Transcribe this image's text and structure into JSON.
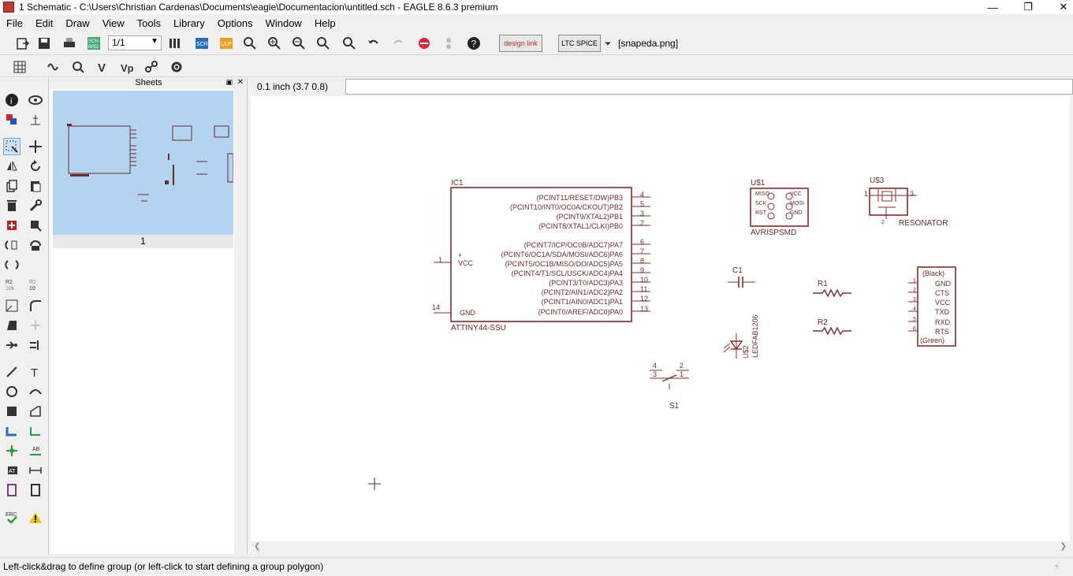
{
  "window": {
    "title": "1 Schematic - C:\\Users\\Christian Cardenas\\Documents\\eagle\\Documentacion\\untitled.sch - EAGLE 8.6.3 premium"
  },
  "menu": [
    "File",
    "Edit",
    "Draw",
    "View",
    "Tools",
    "Library",
    "Options",
    "Window",
    "Help"
  ],
  "toolbar": {
    "sheet_select": "1/1",
    "design_link": "design link",
    "ltc_spice": "LTC SPICE",
    "file_label": "[snapeda.png]"
  },
  "sheets_panel": {
    "title": "Sheets",
    "sheet_number": "1"
  },
  "coord": "0.1 inch (3.7 0.8)",
  "command_input": "",
  "status": "Left-click&drag to define group (or left-click to start defining a group polygon)",
  "schematic": {
    "ic1": {
      "name": "IC1",
      "value": "ATTINY44-SSU",
      "pins_right": [
        {
          "label": "(PCINT11/RESET/DW)PB3",
          "num": "4"
        },
        {
          "label": "(PCINT10/INT0/OC0A/CKOUT)PB2",
          "num": "5"
        },
        {
          "label": "(PCINT9/XTAL2)PB1",
          "num": "3"
        },
        {
          "label": "(PCINT8/XTAL1/CLKI)PB0",
          "num": "2"
        },
        {
          "label": "(PCINT7/ICP/OC0B/ADC7)PA7",
          "num": "6"
        },
        {
          "label": "(PCINT6/OC1A/SDA/MOSI/ADC6)PA6",
          "num": "7"
        },
        {
          "label": "(PCINT5/OC1B/MISO/DO/ADC5)PA5",
          "num": "8"
        },
        {
          "label": "(PCINT4/T1/SCL/USCK/ADC4)PA4",
          "num": "9"
        },
        {
          "label": "(PCINT3/T0/ADC3)PA3",
          "num": "10"
        },
        {
          "label": "(PCINT2/AIN1/ADC2)PA2",
          "num": "11"
        },
        {
          "label": "(PCINT1/AIN0/ADC1)PA1",
          "num": "12"
        },
        {
          "label": "(PCINT0/AREF/ADC0)PA0",
          "num": "13"
        }
      ],
      "vcc": {
        "label": "VCC",
        "num": "1"
      },
      "gnd": {
        "label": "GND",
        "num": "14"
      }
    },
    "us1": {
      "name": "U$1",
      "value": "AVRISPSMD",
      "pins": [
        "MISO",
        "SCK",
        "RST",
        "VCC",
        "MOSI",
        "GND"
      ]
    },
    "us3": {
      "name": "U$3",
      "value": "RESONATOR",
      "pin1": "1",
      "pin2": "2",
      "pin3": "3"
    },
    "c1": {
      "name": "C1"
    },
    "r1": {
      "name": "R1"
    },
    "r2": {
      "name": "R2"
    },
    "us2": {
      "name": "U$2",
      "value": "LEDFAB1206"
    },
    "s1": {
      "name": "S1",
      "pins": [
        "4",
        "3",
        "2",
        "1"
      ]
    },
    "ftdi": {
      "top": "(Black)",
      "bottom": "(Green)",
      "pins": [
        "GND",
        "CTS",
        "VCC",
        "TXD",
        "RXD",
        "RTS"
      ],
      "nums": [
        "1",
        "2",
        "3",
        "4",
        "5",
        "6"
      ]
    }
  }
}
